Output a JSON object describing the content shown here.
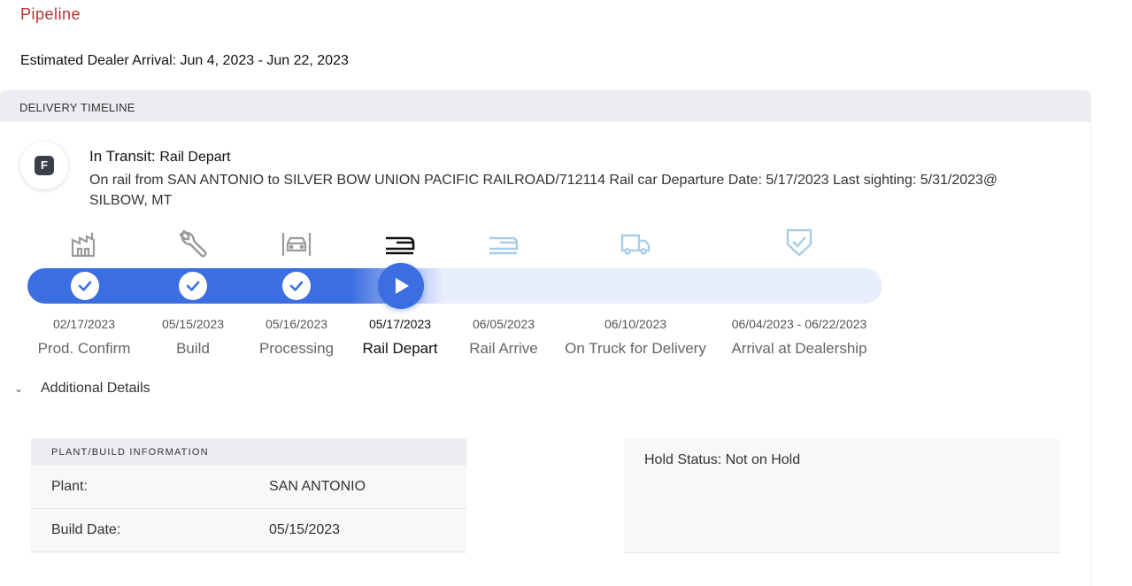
{
  "page": {
    "title": "Pipeline",
    "estimated_arrival": "Estimated Dealer Arrival: Jun 4, 2023 - Jun 22, 2023"
  },
  "timeline": {
    "header": "DELIVERY TIMELINE",
    "avatar_letter": "F",
    "status_prefix": "In Transit:",
    "status_name": "Rail Depart",
    "status_detail": "On rail from SAN ANTONIO to SILVER BOW UNION PACIFIC RAILROAD/712114 Rail car Departure Date: 5/17/2023 Last sighting: 5/31/2023@ SILBOW, MT",
    "progress_completed_steps": 3,
    "current_step_index": 3,
    "steps": [
      {
        "date": "02/17/2023",
        "label": "Prod. Confirm",
        "icon": "factory-icon",
        "state": "complete"
      },
      {
        "date": "05/15/2023",
        "label": "Build",
        "icon": "wrench-icon",
        "state": "complete"
      },
      {
        "date": "05/16/2023",
        "label": "Processing",
        "icon": "vehicle-processing-icon",
        "state": "complete"
      },
      {
        "date": "05/17/2023",
        "label": "Rail Depart",
        "icon": "rail-icon",
        "state": "current"
      },
      {
        "date": "06/05/2023",
        "label": "Rail Arrive",
        "icon": "rail-arrive-icon",
        "state": "upcoming"
      },
      {
        "date": "06/10/2023",
        "label": "On Truck for Delivery",
        "icon": "truck-icon",
        "state": "upcoming"
      },
      {
        "date": "06/04/2023 - 06/22/2023",
        "label": "Arrival at Dealership",
        "icon": "shield-check-icon",
        "state": "upcoming"
      }
    ],
    "colors": {
      "accent": "#3b6ee0",
      "track": "#e9eefc",
      "icon_done": "#9a9a9a",
      "icon_current": "#111111",
      "icon_upcoming": "#a9cde6",
      "title": "#b5322f"
    }
  },
  "details": {
    "toggle_label": "Additional Details",
    "plant": {
      "header": "PLANT/BUILD INFORMATION",
      "rows": [
        {
          "key": "Plant:",
          "value": "SAN ANTONIO"
        },
        {
          "key": "Build Date:",
          "value": "05/15/2023"
        }
      ]
    },
    "hold_status": "Hold Status: Not on Hold"
  }
}
